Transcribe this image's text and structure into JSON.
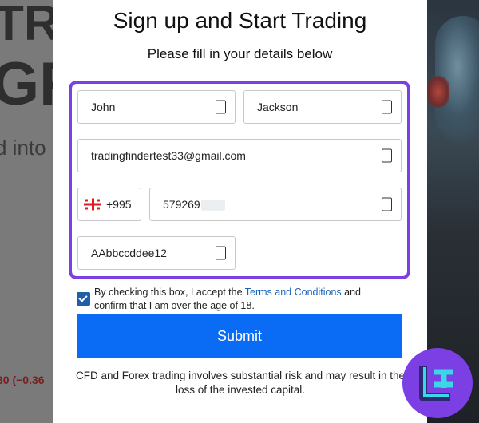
{
  "background": {
    "text_line1": "TR",
    "text_line2": "GR",
    "text_line3": "d into",
    "ticker": "30 (−0.36"
  },
  "modal": {
    "title": "Sign up and Start Trading",
    "subtitle": "Please fill in your details below",
    "fields": {
      "first_name": "John",
      "last_name": "Jackson",
      "email": "tradingfindertest33@gmail.com",
      "country_code": "+995",
      "phone": "579269",
      "password": "AAbbccddee12"
    },
    "consent": {
      "checked": true,
      "text_before": "By checking this box, I accept the ",
      "link": "Terms and Conditions",
      "text_after": " and confirm that I am over the age of 18."
    },
    "submit_label": "Submit",
    "disclaimer": "CFD and Forex trading involves substantial risk and may result in the loss of the invested capital."
  },
  "colors": {
    "accent_border": "#7b3fe4",
    "submit_bg": "#0a6cf5",
    "link": "#1a63b8",
    "badge": "#7b3fe4"
  }
}
